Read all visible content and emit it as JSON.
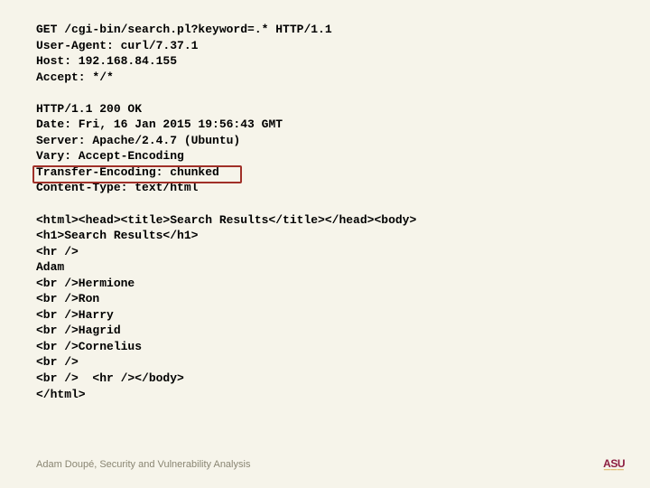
{
  "code": {
    "l1": "GET /cgi-bin/search.pl?keyword=.* HTTP/1.1",
    "l2": "User-Agent: curl/7.37.1",
    "l3": "Host: 192.168.84.155",
    "l4": "Accept: */*",
    "l5": "",
    "l6": "HTTP/1.1 200 OK",
    "l7": "Date: Fri, 16 Jan 2015 19:56:43 GMT",
    "l8": "Server: Apache/2.4.7 (Ubuntu)",
    "l9": "Vary: Accept-Encoding",
    "l10": "Transfer-Encoding: chunked",
    "l11": "Content-Type: text/html",
    "l12": "",
    "l13": "<html><head><title>Search Results</title></head><body>",
    "l14": "<h1>Search Results</h1>",
    "l15": "<hr />",
    "l16": "Adam",
    "l17": "<br />Hermione",
    "l18": "<br />Ron",
    "l19": "<br />Harry",
    "l20": "<br />Hagrid",
    "l21": "<br />Cornelius",
    "l22": "<br />",
    "l23": "<br />  <hr /></body>",
    "l24": "</html>"
  },
  "footer": {
    "text": "Adam Doupé, Security and Vulnerability Analysis"
  },
  "logo": {
    "top": "ASU",
    "bottom": "———"
  }
}
